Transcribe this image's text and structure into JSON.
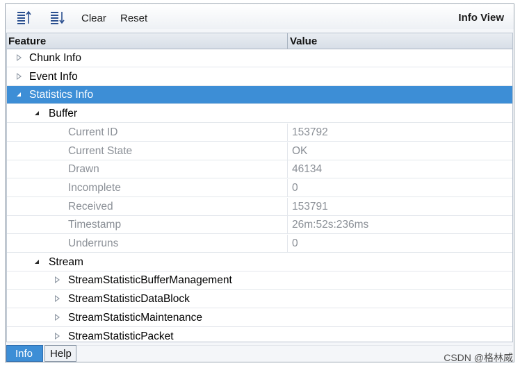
{
  "toolbar": {
    "icons": [
      "sort-ascending-icon",
      "sort-descending-icon"
    ],
    "clear_label": "Clear",
    "reset_label": "Reset",
    "title": "Info View"
  },
  "table": {
    "headers": {
      "feature": "Feature",
      "value": "Value"
    },
    "rows": [
      {
        "label": "Chunk Info",
        "level": 0,
        "state": "collapsed",
        "value": ""
      },
      {
        "label": "Event Info",
        "level": 0,
        "state": "collapsed",
        "value": ""
      },
      {
        "label": "Statistics Info",
        "level": 0,
        "state": "expanded",
        "value": "",
        "selected": true
      },
      {
        "label": "Buffer",
        "level": 1,
        "state": "expanded",
        "value": ""
      },
      {
        "label": "Current ID",
        "level": 2,
        "state": "leaf",
        "value": "153792"
      },
      {
        "label": "Current State",
        "level": 2,
        "state": "leaf",
        "value": "OK"
      },
      {
        "label": "Drawn",
        "level": 2,
        "state": "leaf",
        "value": "46134"
      },
      {
        "label": "Incomplete",
        "level": 2,
        "state": "leaf",
        "value": "0"
      },
      {
        "label": "Received",
        "level": 2,
        "state": "leaf",
        "value": "153791"
      },
      {
        "label": "Timestamp",
        "level": 2,
        "state": "leaf",
        "value": "26m:52s:236ms"
      },
      {
        "label": "Underruns",
        "level": 2,
        "state": "leaf",
        "value": "0"
      },
      {
        "label": "Stream",
        "level": 1,
        "state": "expanded",
        "value": ""
      },
      {
        "label": "StreamStatisticBufferManagement",
        "level": 2,
        "state": "collapsed",
        "value": ""
      },
      {
        "label": "StreamStatisticDataBlock",
        "level": 2,
        "state": "collapsed",
        "value": ""
      },
      {
        "label": "StreamStatisticMaintenance",
        "level": 2,
        "state": "collapsed",
        "value": ""
      },
      {
        "label": "StreamStatisticPacket",
        "level": 2,
        "state": "collapsed",
        "value": ""
      }
    ]
  },
  "tabs": [
    {
      "label": "Info",
      "active": true
    },
    {
      "label": "Help",
      "active": false
    }
  ],
  "watermark": "CSDN @格林威",
  "colors": {
    "selection": "#3d8ed6",
    "icon": "#2a4f8f"
  }
}
